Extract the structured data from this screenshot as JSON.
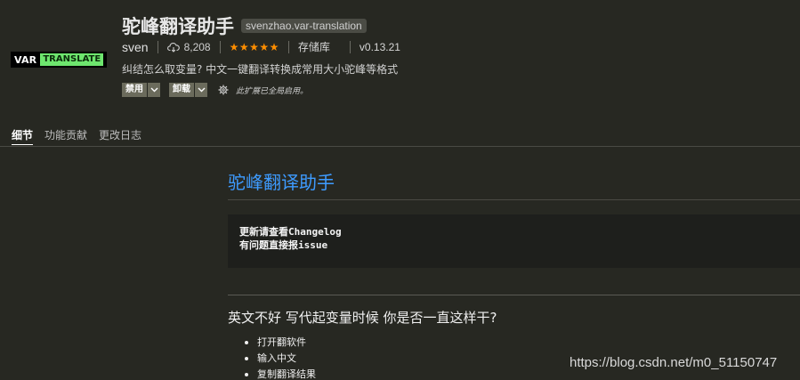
{
  "extension": {
    "logo": {
      "part1": "VAR",
      "part2": "TRANSLATE",
      "accent": "#6ee66e"
    },
    "name": "驼峰翻译助手",
    "id": "svenzhao.var-translation",
    "publisher": "sven",
    "installs": "8,208",
    "rating_stars": "★★★★★",
    "rating": 5,
    "repository": "存储库",
    "version": "v0.13.21",
    "description": "纠结怎么取变量? 中文一键翻译转换成常用大小驼峰等格式",
    "buttons": {
      "disable": "禁用",
      "uninstall": "卸载"
    },
    "status": "此扩展已全局启用。"
  },
  "tabs": [
    {
      "label": "细节",
      "active": true
    },
    {
      "label": "功能贡献",
      "active": false
    },
    {
      "label": "更改日志",
      "active": false
    }
  ],
  "readme": {
    "title": "驼峰翻译助手",
    "code_lines": [
      "更新请查看Changelog",
      "有问题直接报issue"
    ],
    "question": "英文不好 写代起变量时候 你是否一直这样干?",
    "steps": [
      "打开翻软件",
      "输入中文",
      "复制翻译结果"
    ]
  },
  "watermark": "https://blog.csdn.net/m0_51150747",
  "colors": {
    "background": "#272822",
    "link_blue": "#3e9bff",
    "star": "#ff8e00"
  }
}
